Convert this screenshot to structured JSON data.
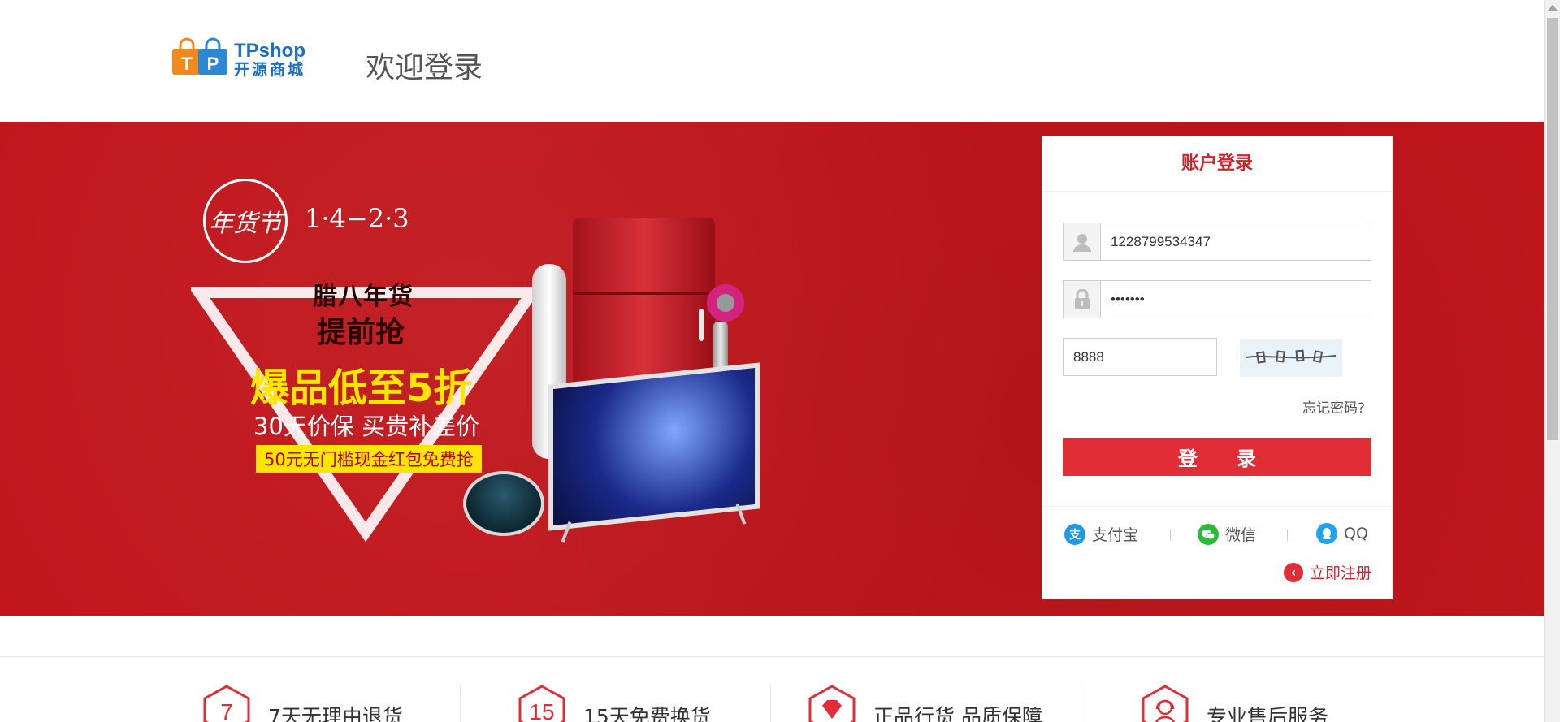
{
  "header": {
    "logo_en": "TPshop",
    "logo_cn": "开源商城",
    "welcome": "欢迎登录"
  },
  "banner": {
    "seal": "年货节",
    "dates": "1·4−2·3",
    "line1": "腊八年货",
    "line2": "提前抢",
    "line3": "爆品低至5折",
    "line4": "30天价保 买贵补差价",
    "tag": "50元无门槛现金红包免费抢"
  },
  "login": {
    "title": "账户登录",
    "username_value": "1228799534347",
    "password_value": "•••••••",
    "captcha_value": "8888",
    "forgot": "忘记密码?",
    "submit": "登 录",
    "alipay": "支付宝",
    "wechat": "微信",
    "qq": "QQ",
    "register": "立即注册"
  },
  "services": [
    {
      "icon_text": "7",
      "label": "7天无理由退货"
    },
    {
      "icon_text": "15",
      "label": "15天免费换货"
    },
    {
      "icon_text": "",
      "label": "正品行货 品质保障"
    },
    {
      "icon_text": "",
      "label": "专业售后服务"
    }
  ],
  "colors": {
    "brand_red": "#c0161c",
    "button_red": "#e12d36",
    "logo_blue": "#1a6fc4"
  }
}
